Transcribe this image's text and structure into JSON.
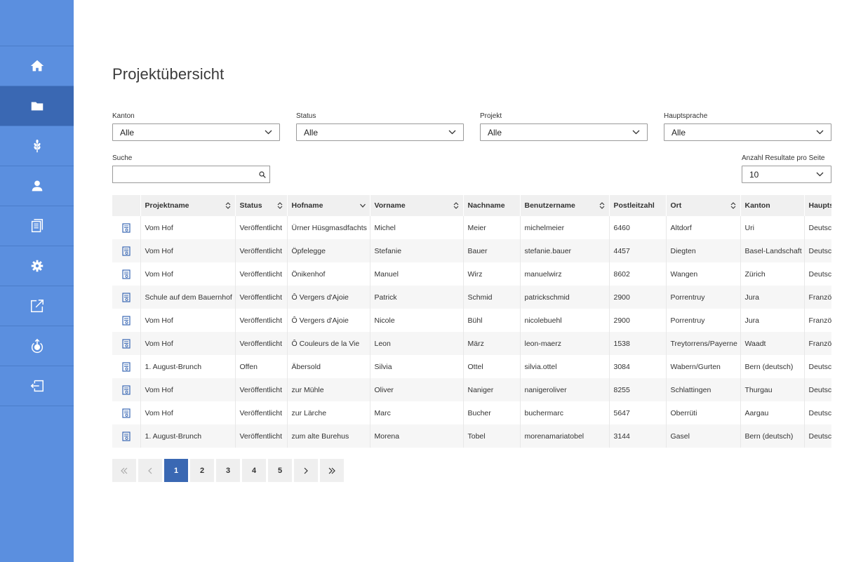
{
  "colors": {
    "sidebar": "#5b8fdf",
    "sidebar_active": "#3a68b3",
    "accent": "#3a68b3",
    "row_alt": "#f6f6f6"
  },
  "sidebar": {
    "items": [
      {
        "icon": "home-icon",
        "active": false
      },
      {
        "icon": "folder-icon",
        "active": true
      },
      {
        "icon": "wheat-icon",
        "active": false
      },
      {
        "icon": "user-icon",
        "active": false
      },
      {
        "icon": "documents-icon",
        "active": false
      },
      {
        "icon": "gear-icon",
        "active": false
      },
      {
        "icon": "external-link-icon",
        "active": false
      },
      {
        "icon": "upload-refresh-icon",
        "active": false
      },
      {
        "icon": "logout-icon",
        "active": false
      }
    ]
  },
  "page": {
    "title": "Projektübersicht"
  },
  "filters": {
    "kanton": {
      "label": "Kanton",
      "value": "Alle"
    },
    "status": {
      "label": "Status",
      "value": "Alle"
    },
    "projekt": {
      "label": "Projekt",
      "value": "Alle"
    },
    "hauptsprache": {
      "label": "Hauptsprache",
      "value": "Alle"
    }
  },
  "search": {
    "label": "Suche",
    "value": ""
  },
  "perpage": {
    "label": "Anzahl Resultate pro Seite",
    "value": "10"
  },
  "table": {
    "columns": [
      "",
      "Projektname",
      "Status",
      "Hofname",
      "Vorname",
      "Nachname",
      "Benutzername",
      "Postleitzahl",
      "Ort",
      "Kanton",
      "Hauptsprache"
    ],
    "rows": [
      [
        "Vom Hof",
        "Veröffentlicht",
        "Ürner Hüsgmasdfachts",
        "Michel",
        "Meier",
        "michelmeier",
        "6460",
        "Altdorf",
        "Uri",
        "Deutsch"
      ],
      [
        "Vom Hof",
        "Veröffentlicht",
        "Öpfelegge",
        "Stefanie",
        "Bauer",
        "stefanie.bauer",
        "4457",
        "Diegten",
        "Basel-Landschaft",
        "Deutsch"
      ],
      [
        "Vom Hof",
        "Veröffentlicht",
        "Önikenhof",
        "Manuel",
        "Wirz",
        "manuelwirz",
        "8602",
        "Wangen",
        "Zürich",
        "Deutsch"
      ],
      [
        "Schule auf dem Bauernhof",
        "Veröffentlicht",
        "Ô Vergers d'Ajoie",
        "Patrick",
        "Schmid",
        "patrickschmid",
        "2900",
        "Porrentruy",
        "Jura",
        "Französisch"
      ],
      [
        "Vom Hof",
        "Veröffentlicht",
        "Ô Vergers d'Ajoie",
        "Nicole",
        "Bühl",
        "nicolebuehl",
        "2900",
        "Porrentruy",
        "Jura",
        "Französisch"
      ],
      [
        "Vom Hof",
        "Veröffentlicht",
        "Ô Couleurs de la Vie",
        "Leon",
        "März",
        "leon-maerz",
        "1538",
        "Treytorrens/Payerne",
        "Waadt",
        "Französisch"
      ],
      [
        "1. August-Brunch",
        "Offen",
        "Äbersold",
        "Silvia",
        "Ottel",
        "silvia.ottel",
        "3084",
        "Wabern/Gurten",
        "Bern (deutsch)",
        "Deutsch"
      ],
      [
        "Vom Hof",
        "Veröffentlicht",
        "zur Mühle",
        "Oliver",
        "Naniger",
        "nanigeroliver",
        "8255",
        "Schlattingen",
        "Thurgau",
        "Deutsch"
      ],
      [
        "Vom Hof",
        "Veröffentlicht",
        "zur Lärche",
        "Marc",
        "Bucher",
        "buchermarc",
        "5647",
        "Oberrüti",
        "Aargau",
        "Deutsch"
      ],
      [
        "1. August-Brunch",
        "Veröffentlicht",
        "zum alte Burehus",
        "Morena",
        "Tobel",
        "morenamariatobel",
        "3144",
        "Gasel",
        "Bern (deutsch)",
        "Deutsch"
      ]
    ]
  },
  "pagination": {
    "pages": [
      "1",
      "2",
      "3",
      "4",
      "5"
    ],
    "current": "1"
  }
}
